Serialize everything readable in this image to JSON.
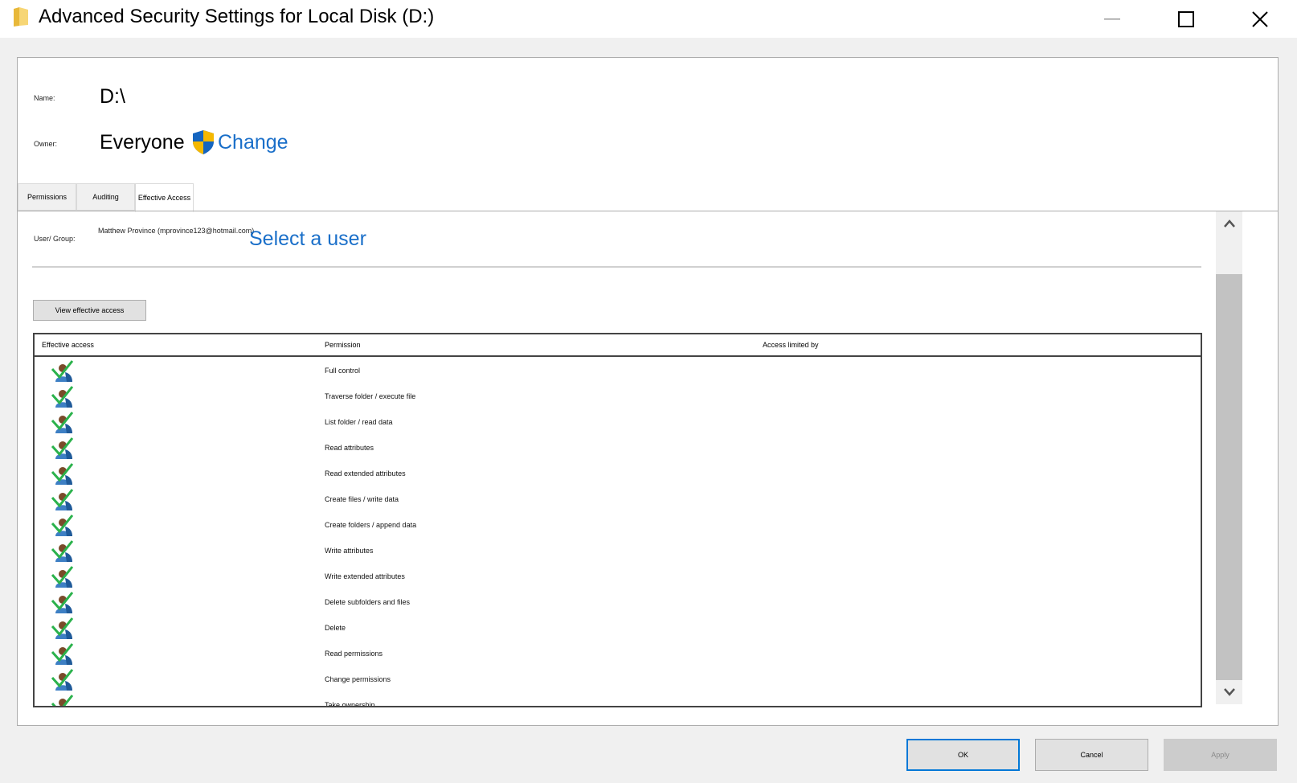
{
  "window": {
    "title": "Advanced Security Settings for Local Disk (D:)",
    "icons": [
      "folder-icon",
      "minimize-icon",
      "maximize-icon",
      "close-icon"
    ]
  },
  "header": {
    "name_label": "Name:",
    "name_value": "D:\\",
    "owner_label": "Owner:",
    "owner_value": "Everyone",
    "change_label": "Change"
  },
  "tabs": [
    {
      "label": "Permissions",
      "selected": false
    },
    {
      "label": "Auditing",
      "selected": false
    },
    {
      "label": "Effective Access",
      "selected": true
    }
  ],
  "effective": {
    "user_group_label": "User/ Group:",
    "user_value": "Matthew Province (mprovince123@hotmail.com)",
    "select_user_label": "Select a user",
    "view_button_label": "View effective access"
  },
  "table": {
    "columns": [
      "Effective access",
      "Permission",
      "Access limited by"
    ],
    "rows": [
      {
        "permission": "Full control",
        "icon": "user-check-icon"
      },
      {
        "permission": "Traverse folder / execute file",
        "icon": "user-check-icon"
      },
      {
        "permission": "List folder / read data",
        "icon": "user-check-icon"
      },
      {
        "permission": "Read attributes",
        "icon": "user-check-icon"
      },
      {
        "permission": "Read extended attributes",
        "icon": "user-check-icon"
      },
      {
        "permission": "Create files / write data",
        "icon": "user-check-icon"
      },
      {
        "permission": "Create folders / append data",
        "icon": "user-check-icon"
      },
      {
        "permission": "Write attributes",
        "icon": "user-check-icon"
      },
      {
        "permission": "Write extended attributes",
        "icon": "user-check-icon"
      },
      {
        "permission": "Delete subfolders and files",
        "icon": "user-check-icon"
      },
      {
        "permission": "Delete",
        "icon": "user-check-icon"
      },
      {
        "permission": "Read permissions",
        "icon": "user-check-icon"
      },
      {
        "permission": "Change permissions",
        "icon": "user-check-icon"
      },
      {
        "permission": "Take ownership",
        "icon": "user-check-icon"
      }
    ]
  },
  "footer": {
    "ok_label": "OK",
    "cancel_label": "Cancel",
    "apply_label": "Apply",
    "apply_enabled": false
  },
  "colors": {
    "link": "#1a6fc9",
    "ok_border": "#0078d7",
    "check": "#2bb24c"
  }
}
